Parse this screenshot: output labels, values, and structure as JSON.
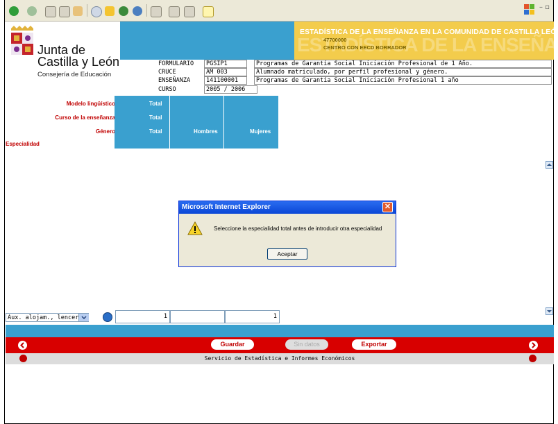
{
  "colors": {
    "blue": "#3aa0cf",
    "gold": "#f3cc4c",
    "red": "#d80000",
    "label_red": "#c00000"
  },
  "header": {
    "org_line1": "Junta de",
    "org_line2": "Castilla y León",
    "org_dept": "Consejería de Educación",
    "banner_title": "ESTADÍSTICA DE LA ENSEÑANZA EN LA COMUNIDAD DE CASTILLA LEÓN",
    "banner_code": "47700000",
    "banner_subtitle": "CENTRO CON EECD BORRADOR"
  },
  "form_fields": [
    {
      "label": "FORMULARIO",
      "code": "PGSIP1",
      "desc": "Programas de Garantía Social Iniciación Profesional de 1 Año."
    },
    {
      "label": "CRUCE",
      "code": "AM 003",
      "desc": "Alumnado matriculado, por perfil profesional y género."
    },
    {
      "label": "ENSEÑANZA",
      "code": "141100001",
      "desc": "Programas de Garantía Social Iniciación Profesional 1 año"
    },
    {
      "label": "CURSO",
      "code": "2005 / 2006",
      "desc": ""
    }
  ],
  "matrix": {
    "row_labels": [
      "Modelo lingüístico",
      "Curso de la enseñanza",
      "Género"
    ],
    "col_total": [
      "Total",
      "Total",
      "Total"
    ],
    "genero_cols": [
      "Hombres",
      "Mujeres"
    ],
    "especialidad_label": "Especialidad"
  },
  "data_row": {
    "especialidad_selected": "Aux. alojam., lencería",
    "total": "1",
    "hombres": "",
    "mujeres": "1"
  },
  "toolbar": {
    "save_label": "Guardar",
    "nodata_label": "Sin datos",
    "export_label": "Exportar"
  },
  "footer": {
    "text": "Servicio de Estadística e Informes Económicos"
  },
  "dialog": {
    "title": "Microsoft Internet Explorer",
    "message": "Seleccione la especialidad total antes de introducir otra especialidad",
    "ok_label": "Aceptar",
    "close_symbol": "✕"
  },
  "icons": {
    "warning": "warning-icon",
    "home": "home-icon",
    "exit": "exit-icon",
    "back": "back-arrow-icon",
    "forward": "forward-arrow-icon"
  }
}
